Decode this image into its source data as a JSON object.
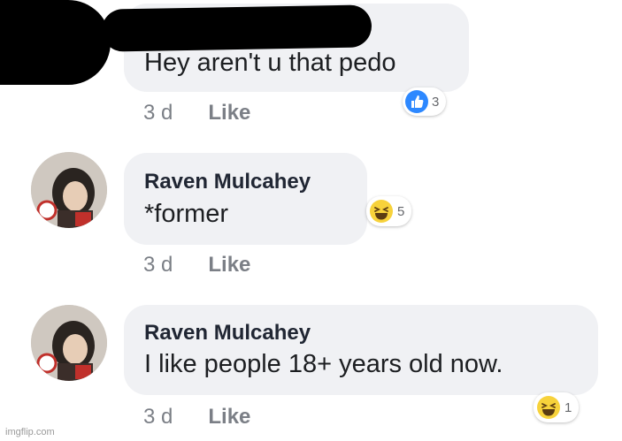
{
  "comments": [
    {
      "author": "",
      "text": "Hey aren't u that pedo",
      "time": "3 d",
      "like_label": "Like",
      "reaction": {
        "icon": "thumbs-up-icon",
        "count": "3"
      }
    },
    {
      "author": "Raven Mulcahey",
      "text": "*former",
      "time": "3 d",
      "like_label": "Like",
      "reaction": {
        "icon": "laugh-emoji-icon",
        "count": "5"
      }
    },
    {
      "author": "Raven Mulcahey",
      "text": "I like people 18+ years old now.",
      "time": "3 d",
      "like_label": "Like",
      "reaction": {
        "icon": "laugh-emoji-icon",
        "count": "1"
      }
    }
  ],
  "watermark": "imgflip.com",
  "colors": {
    "bubble": "#f0f1f4",
    "like_blue": "#2d88ff",
    "haha_yellow": "#f7d23b"
  }
}
